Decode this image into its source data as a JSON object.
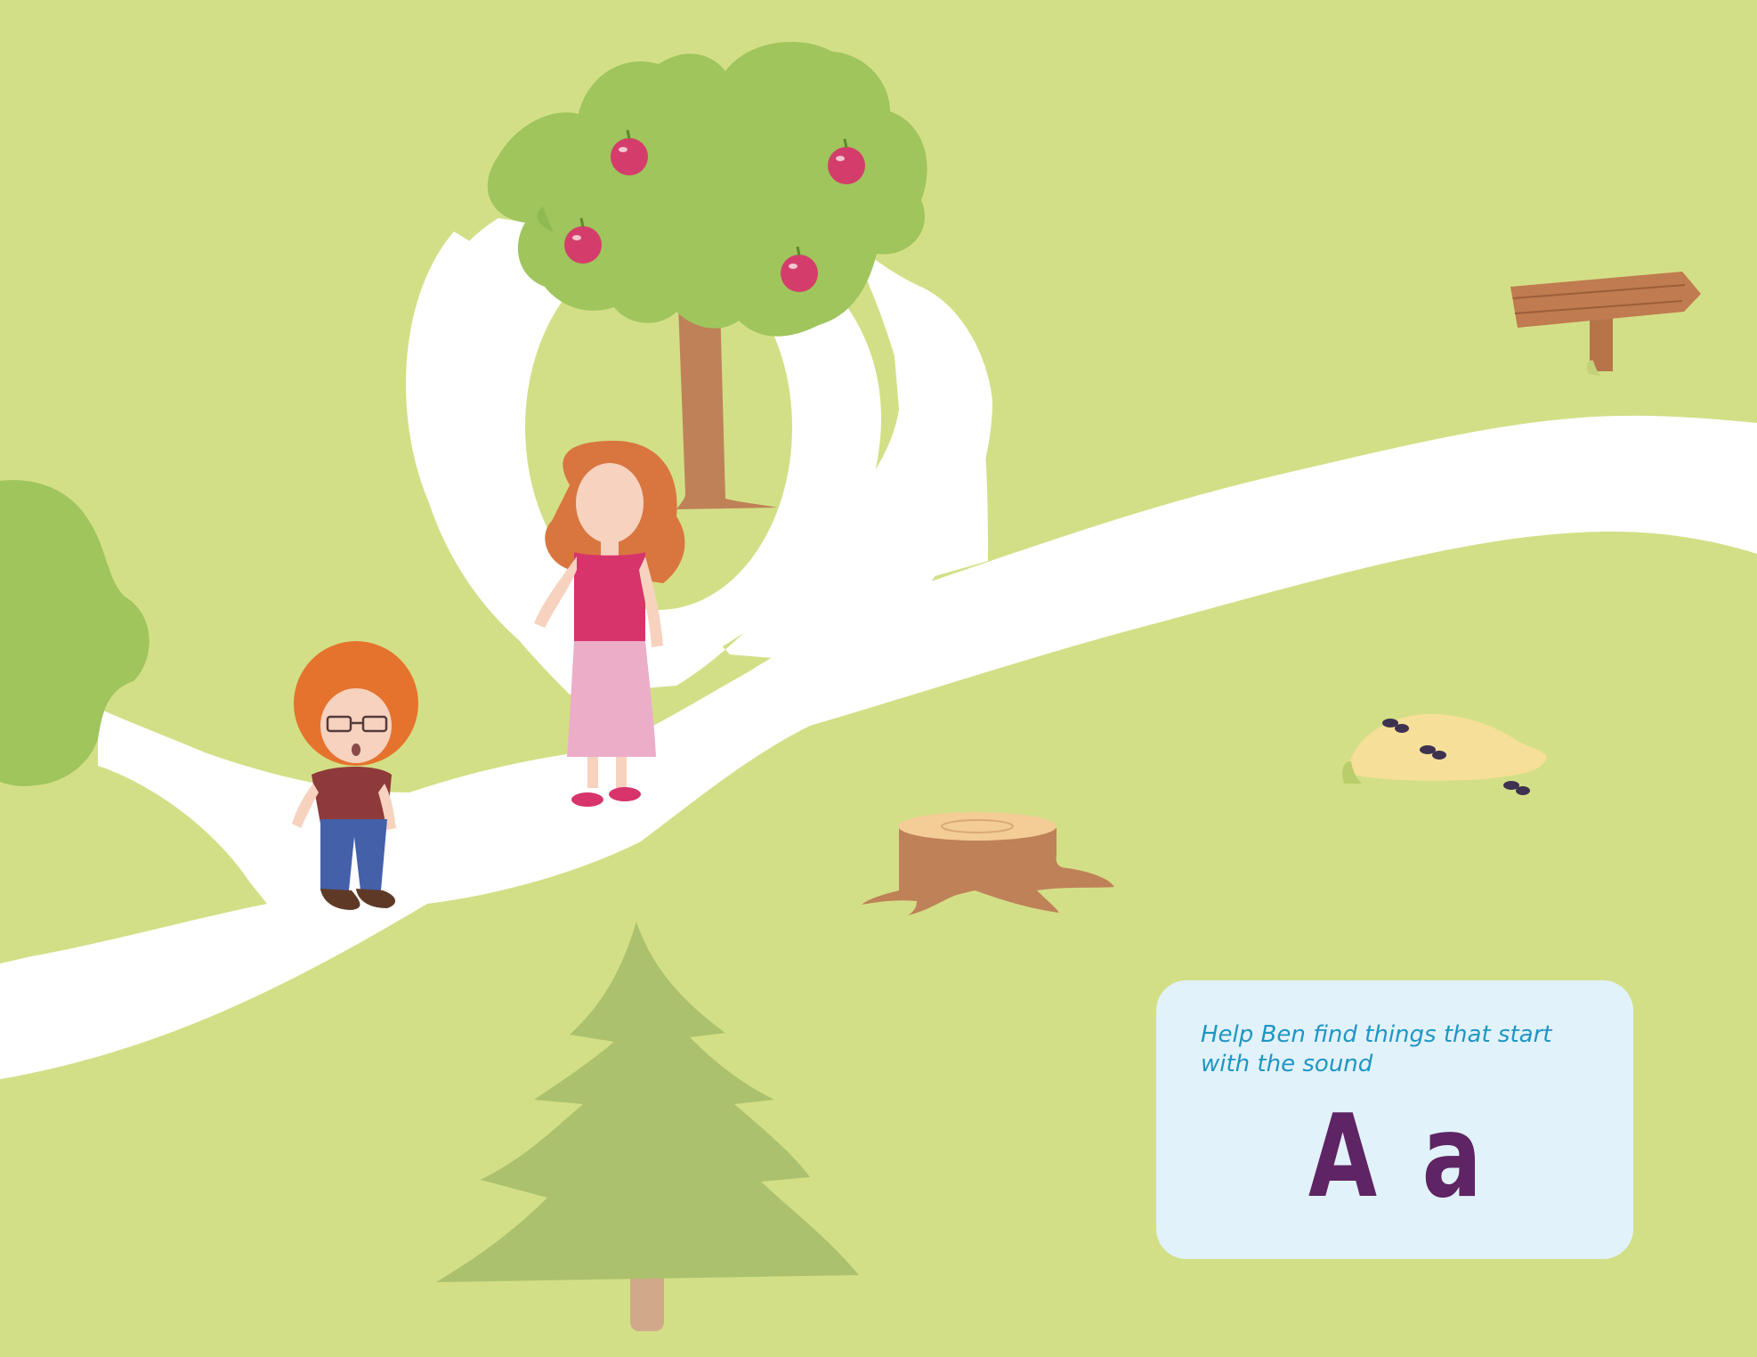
{
  "scene": {
    "background_color": "#d3df86",
    "path_color": "#ffffff",
    "characters": [
      {
        "name": "Ben",
        "role": "boy"
      },
      {
        "name": "",
        "role": "woman"
      }
    ],
    "objects": [
      "apple-tree",
      "bush",
      "signpost",
      "ant-hill",
      "tree-stump",
      "pine-tree"
    ]
  },
  "prompt_card": {
    "instruction": "Help Ben find things that start with the sound",
    "letter_upper": "A",
    "letter_lower": "a",
    "card_color": "#e2f2fb",
    "instruction_color": "#1e96c3",
    "letter_color": "#5e2464"
  }
}
